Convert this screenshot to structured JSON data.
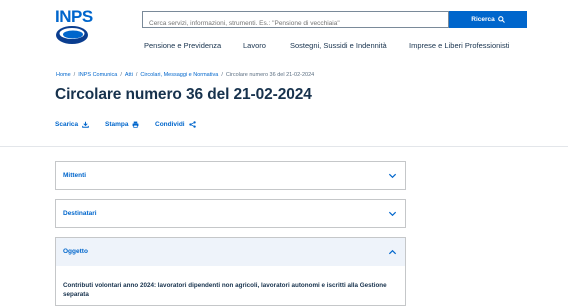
{
  "logo": {
    "text": "INPS"
  },
  "search": {
    "placeholder": "Cerca servizi, informazioni, strumenti. Es.: \"Pensione di vecchiaia\"",
    "button_label": "Ricerca"
  },
  "nav": {
    "items": [
      "Pensione e Previdenza",
      "Lavoro",
      "Sostegni, Sussidi e Indennità",
      "Imprese e Liberi Professionisti"
    ]
  },
  "breadcrumb": {
    "items": [
      "Home",
      "INPS Comunica",
      "Atti",
      "Circolari, Messaggi e Normativa"
    ],
    "current": "Circolare numero 36 del 21-02-2024"
  },
  "page_title": "Circolare numero 36 del 21-02-2024",
  "actions": {
    "download": "Scarica",
    "print": "Stampa",
    "share": "Condividi"
  },
  "accordion": [
    {
      "label": "Mittenti",
      "expanded": false
    },
    {
      "label": "Destinatari",
      "expanded": false
    },
    {
      "label": "Oggetto",
      "expanded": true,
      "content": "Contributi volontari anno 2024: lavoratori dipendenti non agricoli, lavoratori autonomi e iscritti alla Gestione separata"
    }
  ],
  "colors": {
    "accent": "#0066cc",
    "text": "#17324d",
    "open_panel_bg": "#eef3fa"
  }
}
